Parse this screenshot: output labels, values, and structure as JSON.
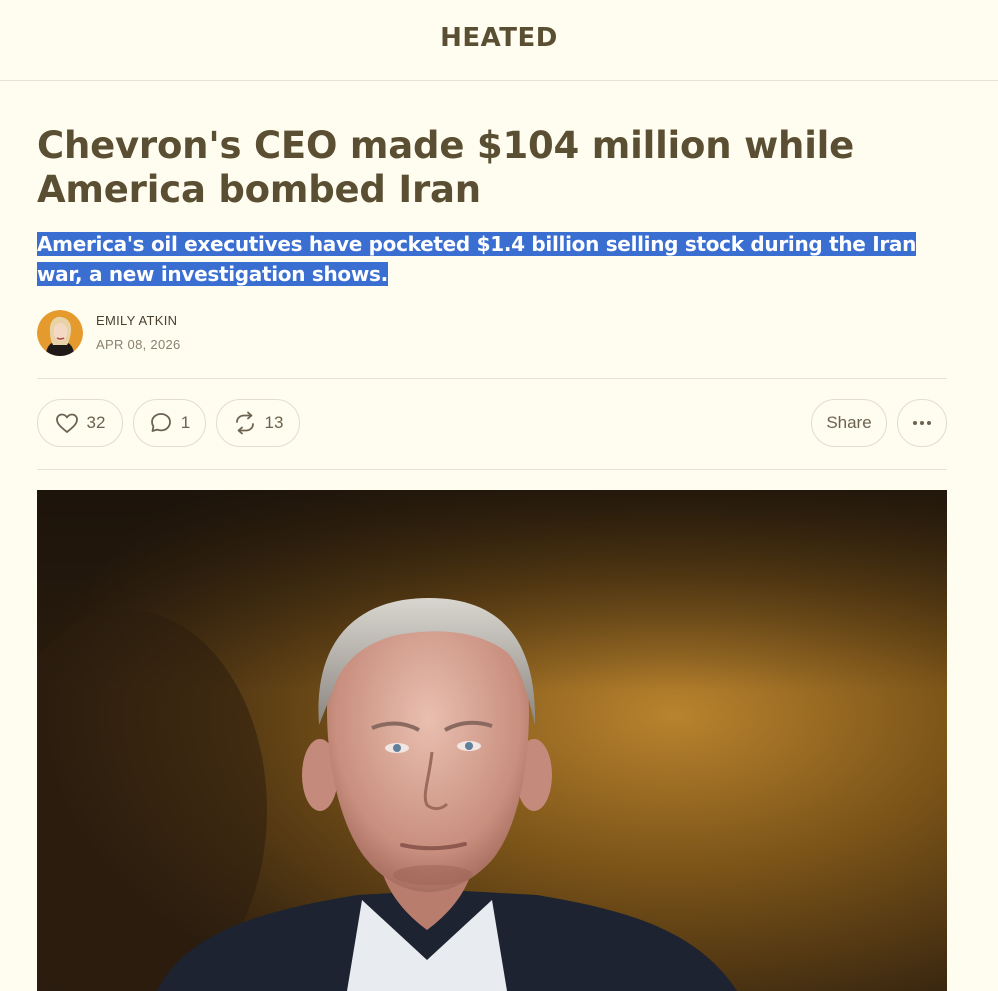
{
  "header": {
    "publication": "HEATED"
  },
  "article": {
    "title": "Chevron's CEO made $104 million while America bombed Iran",
    "subtitle": "America's oil executives have pocketed $1.4 billion selling stock during the Iran war, a new investigation shows.",
    "author": "EMILY ATKIN",
    "date": "APR 08, 2026"
  },
  "actions": {
    "like_count": "32",
    "comment_count": "1",
    "restack_count": "13",
    "share_label": "Share",
    "icons": {
      "like": "heart-icon",
      "comment": "speech-bubble-icon",
      "restack": "restack-arrows-icon",
      "more": "ellipsis-icon"
    }
  },
  "colors": {
    "background": "#fffcf0",
    "heading": "#5b4f33",
    "selection": "#3a6fd1"
  }
}
